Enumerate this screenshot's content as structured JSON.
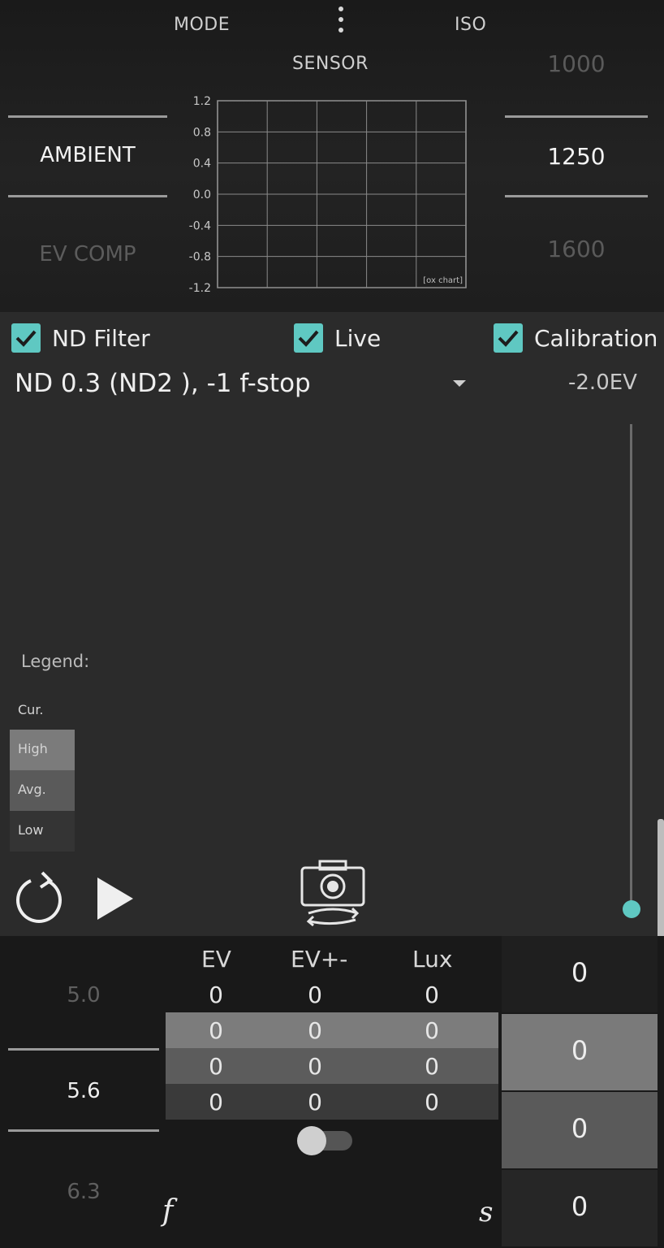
{
  "header": {
    "mode_label": "MODE",
    "iso_label": "ISO",
    "sensor_label": "SENSOR"
  },
  "mode_picker": {
    "selected": "AMBIENT",
    "next": "EV COMP"
  },
  "iso_picker": {
    "prev": "1000",
    "selected": "1250",
    "next": "1600"
  },
  "chart_data": {
    "type": "line",
    "title": "",
    "xlabel": "",
    "ylabel": "",
    "y_ticks": [
      "1.2",
      "0.8",
      "0.4",
      "0.0",
      "-0.4",
      "-0.8",
      "-1.2"
    ],
    "ylim": [
      -1.2,
      1.2
    ],
    "grid": true,
    "annotation": "[ox chart]",
    "series": []
  },
  "options": {
    "nd_filter": "ND Filter",
    "live": "Live",
    "calibration": "Calibration"
  },
  "nd_select": {
    "value": "ND 0.3 (ND2 ), -1 f-stop"
  },
  "ev_readout": "-2.0EV",
  "slider": {
    "value_fraction": 0.0,
    "accent": "#5fc8c2"
  },
  "legend": {
    "title": "Legend:",
    "cur": "Cur.",
    "high": "High",
    "avg": "Avg.",
    "low": "Low"
  },
  "icons": {
    "reset": "reset-icon",
    "play": "play-icon",
    "camera": "camera-switch-icon",
    "more": "more-vertical-icon"
  },
  "aperture": {
    "prev": "5.0",
    "selected": "5.6",
    "next": "6.3",
    "label": "f"
  },
  "table": {
    "headers": [
      "EV",
      "EV+-",
      "Lux"
    ],
    "rows": [
      [
        "0",
        "0",
        "0"
      ],
      [
        "0",
        "0",
        "0"
      ],
      [
        "0",
        "0",
        "0"
      ],
      [
        "0",
        "0",
        "0"
      ]
    ]
  },
  "shutter": {
    "values": [
      "0",
      "0",
      "0",
      "0"
    ],
    "label": "s"
  }
}
